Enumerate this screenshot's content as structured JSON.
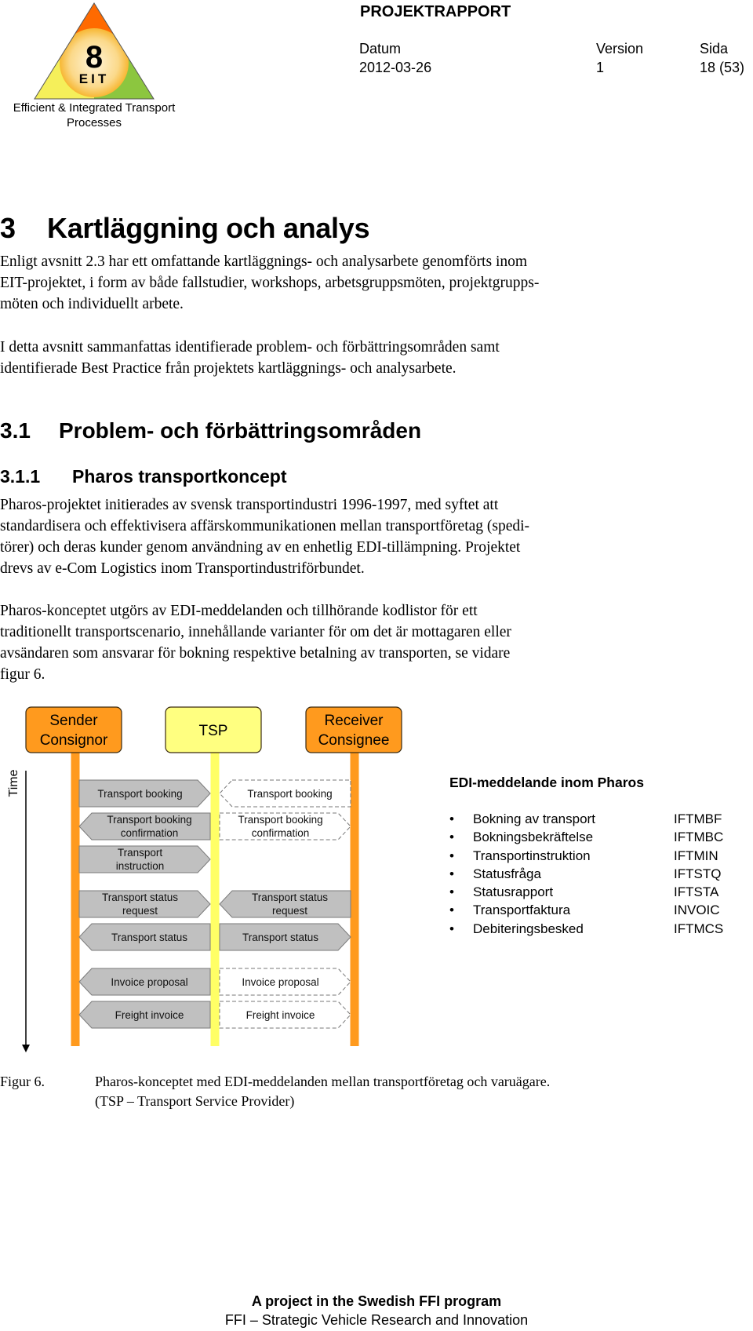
{
  "logo": {
    "number": "8",
    "acronym": "EIT",
    "caption_line1": "Efficient & Integrated Transport",
    "caption_line2": "Processes",
    "colors": {
      "top": "#ff6a00",
      "left": "#f5ef5a",
      "right": "#8cc63f",
      "circle": "#fbd27a"
    }
  },
  "header": {
    "title": "PROJEKTRAPPORT",
    "date_label": "Datum",
    "date_value": "2012-03-26",
    "version_label": "Version",
    "version_value": "1",
    "page_label": "Sida",
    "page_value": "18 (53)"
  },
  "section": {
    "number": "3",
    "title": "Kartläggning och analys",
    "para1": [
      "Enligt avsnitt 2.3 har ett omfattande kartläggnings- och analysarbete genomförts inom",
      "EIT-projektet, i form av både fallstudier, workshops, arbetsgruppsmöten, projektgrupps-",
      "möten och individuellt arbete."
    ],
    "para2": [
      "I detta avsnitt sammanfattas identifierade problem- och förbättringsområden samt",
      "identifierade Best Practice från projektets kartläggnings- och analysarbete."
    ]
  },
  "subsection": {
    "number": "3.1",
    "title": "Problem- och förbättringsområden"
  },
  "subsubsection": {
    "number": "3.1.1",
    "title": "Pharos transportkoncept",
    "para1": [
      "Pharos-projektet initierades av svensk transportindustri 1996-1997, med syftet att",
      "standardisera och effektivisera affärskommunikationen mellan transportföretag (spedi-",
      "törer) och deras kunder genom användning av en enhetlig EDI-tillämpning. Projektet",
      "drevs av e-Com Logistics inom Transportindustriförbundet."
    ],
    "para2": [
      "Pharos-konceptet utgörs av EDI-meddelanden och tillhörande kodlistor för ett",
      "traditionellt transportscenario, innehållande varianter för om det är mottagaren eller",
      "avsändaren som ansvarar för bokning respektive betalning av transporten, se vidare",
      "figur 6."
    ]
  },
  "figure": {
    "actors": [
      {
        "line1": "Sender",
        "line2": "Consignor",
        "color": "#ff9a1e"
      },
      {
        "line1": "TSP",
        "line2": "",
        "color": "#ffff80"
      },
      {
        "line1": "Receiver",
        "line2": "Consignee",
        "color": "#ff9a1e"
      }
    ],
    "time_label": "Time",
    "messages": [
      {
        "left": {
          "text": [
            "Transport booking"
          ],
          "dir": "right",
          "style": "solid"
        },
        "right": {
          "text": [
            "Transport booking"
          ],
          "dir": "left",
          "style": "dashed"
        }
      },
      {
        "left": {
          "text": [
            "Transport booking",
            "confirmation"
          ],
          "dir": "left",
          "style": "solid"
        },
        "right": {
          "text": [
            "Transport booking",
            "confirmation"
          ],
          "dir": "right",
          "style": "dashed"
        }
      },
      {
        "left": {
          "text": [
            "Transport",
            "instruction"
          ],
          "dir": "right",
          "style": "solid"
        },
        "right": null
      },
      {
        "left": {
          "text": [
            "Transport status",
            "request"
          ],
          "dir": "right",
          "style": "solid"
        },
        "right": {
          "text": [
            "Transport status",
            "request"
          ],
          "dir": "left",
          "style": "solid"
        }
      },
      {
        "left": {
          "text": [
            "Transport status"
          ],
          "dir": "left",
          "style": "solid"
        },
        "right": {
          "text": [
            "Transport status"
          ],
          "dir": "right",
          "style": "solid"
        }
      },
      {
        "left": {
          "text": [
            "Invoice proposal"
          ],
          "dir": "left",
          "style": "solid"
        },
        "right": {
          "text": [
            "Invoice proposal"
          ],
          "dir": "right",
          "style": "dashed"
        }
      },
      {
        "left": {
          "text": [
            "Freight invoice"
          ],
          "dir": "left",
          "style": "solid"
        },
        "right": {
          "text": [
            "Freight invoice"
          ],
          "dir": "right",
          "style": "dashed"
        }
      }
    ],
    "edi_title": "EDI-meddelande inom Pharos",
    "edi_messages": [
      {
        "name": "Bokning av transport",
        "code": "IFTMBF"
      },
      {
        "name": "Bokningsbekräftelse",
        "code": "IFTMBC"
      },
      {
        "name": "Transportinstruktion",
        "code": "IFTMIN"
      },
      {
        "name": "Statusfråga",
        "code": "IFTSTQ"
      },
      {
        "name": "Statusrapport",
        "code": "IFTSTA"
      },
      {
        "name": "Transportfaktura",
        "code": "INVOIC"
      },
      {
        "name": "Debiteringsbesked",
        "code": "IFTMCS"
      }
    ],
    "bullet": "•",
    "caption_label": "Figur 6.",
    "caption_line1": "Pharos-konceptet med EDI-meddelanden mellan transportföretag och varuägare.",
    "caption_line2": "(TSP – Transport Service Provider)"
  },
  "footer": {
    "line1": "A project in the Swedish FFI program",
    "line2": "FFI – Strategic Vehicle Research and Innovation"
  }
}
